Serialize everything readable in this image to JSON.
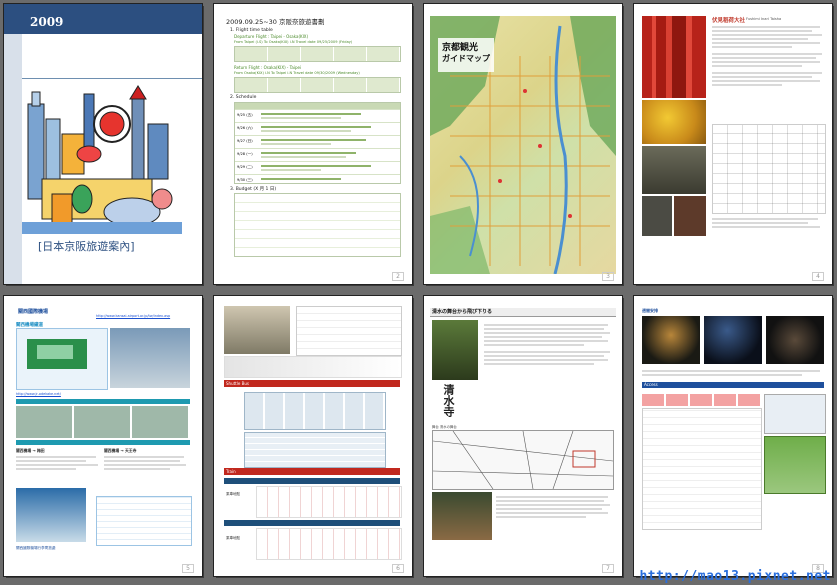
{
  "cover": {
    "year": "2009",
    "title": "[日本京阪旅遊案內]"
  },
  "p2": {
    "heading": "2009.09.25~30 京阪奈旅遊書劃",
    "flight_title": "1.  Flight time table",
    "departure_label": "Departure Flight : Taipei - Osaka(KIX)",
    "departure_route": "From Taipei (i.S)   To  Osaka(KIX) i.N   Travel date 09/25/2009 (Friday)",
    "return_label": "Return Flight : Osaka(KIX) - Taipei",
    "return_route": "From  Osaka(KIX) i.N  To  Taipei i.N   Travel date 09/30/2009 (Wednesday)",
    "schedule_title": "2.  Schedule",
    "budget_title": "3.  Budget (X 月 1 日)",
    "days": [
      "9/25 (五)",
      "9/26 (六)",
      "9/27 (日)",
      "9/28 (一)",
      "9/29 (二)",
      "9/30 (三)"
    ]
  },
  "p3": {
    "title": "京都観光",
    "subtitle": "ガイドマップ"
  },
  "p4": {
    "title": "伏見稻荷大社",
    "subtitle": "Fushimi Inari Taisha"
  },
  "p5": {
    "brand": "關西國際機場",
    "url": "http://www.kansai-airport.or.jp/tw/index.asp",
    "section1": "關西機場鐵道",
    "url2": "http://www.jr-odekake.net/",
    "caption": "關西國際機場行李寄放處",
    "col1_title": "關西機場 → 梅田",
    "col2_title": "關西機場 → 天王寺"
  },
  "p6": {
    "section1": "Shuttle Bus",
    "section2": "Train",
    "row1": "乘車地點",
    "row2": "乘車地點"
  },
  "p7": {
    "header": "清水の舞台から飛び下りる",
    "vertical_title": "清水寺",
    "caption": "舞台 清水の舞台"
  },
  "p8": {
    "section1": "週間安排",
    "section2": "Access"
  },
  "watermark": "http://mao13.pixnet.net"
}
